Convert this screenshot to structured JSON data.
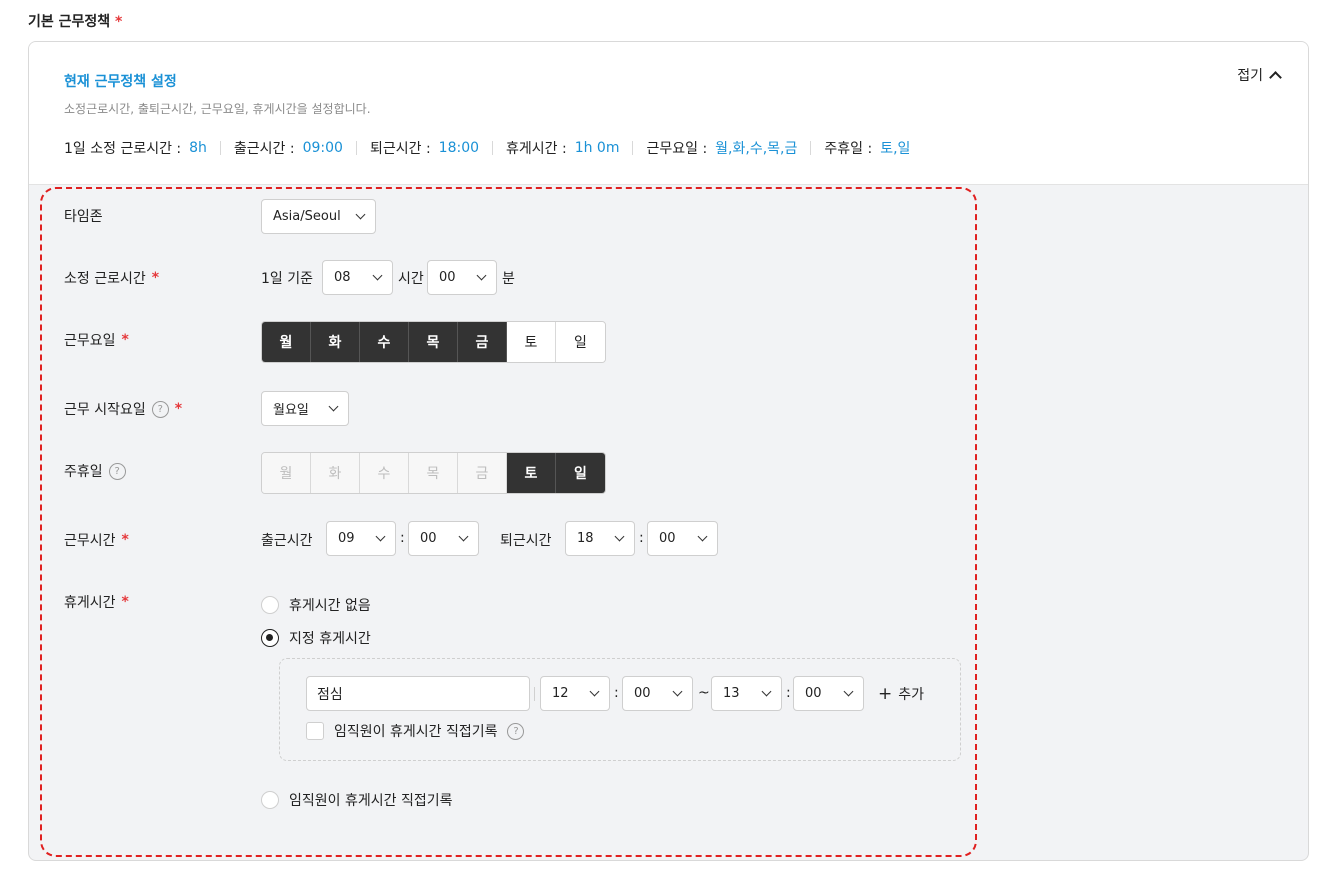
{
  "section": {
    "title": "기본 근무정책",
    "required_mark": "*"
  },
  "header": {
    "title": "현재 근무정책 설정",
    "description": "소정근로시간, 출퇴근시간, 근무요일, 휴게시간을 설정합니다.",
    "collapse_label": "접기",
    "summary": [
      {
        "label": "1일 소정 근로시간 :",
        "value": "8h"
      },
      {
        "label": "출근시간 :",
        "value": "09:00"
      },
      {
        "label": "퇴근시간 :",
        "value": "18:00"
      },
      {
        "label": "휴게시간 :",
        "value": "1h 0m"
      },
      {
        "label": "근무요일 :",
        "value": "월,화,수,목,금"
      },
      {
        "label": "주휴일 :",
        "value": "토,일"
      }
    ]
  },
  "form": {
    "timezone": {
      "label": "타임존",
      "value": "Asia/Seoul"
    },
    "work_hours": {
      "label": "소정 근로시간",
      "prefix": "1일 기준",
      "hours": "08",
      "hours_unit": "시간",
      "minutes": "00",
      "minutes_unit": "분"
    },
    "work_days": {
      "label": "근무요일",
      "days": [
        {
          "label": "월",
          "selected": true
        },
        {
          "label": "화",
          "selected": true
        },
        {
          "label": "수",
          "selected": true
        },
        {
          "label": "목",
          "selected": true
        },
        {
          "label": "금",
          "selected": true
        },
        {
          "label": "토",
          "selected": false
        },
        {
          "label": "일",
          "selected": false
        }
      ]
    },
    "week_start": {
      "label": "근무 시작요일",
      "value": "월요일"
    },
    "weekly_holiday": {
      "label": "주휴일",
      "days": [
        {
          "label": "월",
          "state": "disabled"
        },
        {
          "label": "화",
          "state": "disabled"
        },
        {
          "label": "수",
          "state": "disabled"
        },
        {
          "label": "목",
          "state": "disabled"
        },
        {
          "label": "금",
          "state": "disabled"
        },
        {
          "label": "토",
          "state": "selected"
        },
        {
          "label": "일",
          "state": "selected"
        }
      ]
    },
    "work_time": {
      "label": "근무시간",
      "start_label": "출근시간",
      "start_hour": "09",
      "start_min": "00",
      "end_label": "퇴근시간",
      "end_hour": "18",
      "end_min": "00",
      "colon": ":"
    },
    "break_time": {
      "label": "휴게시간",
      "options": [
        {
          "label": "휴게시간 없음",
          "checked": false
        },
        {
          "label": "지정 휴게시간",
          "checked": true
        },
        {
          "label": "임직원이 휴게시간 직접기록",
          "checked": false
        }
      ],
      "entry": {
        "name": "점심",
        "start_hour": "12",
        "start_min": "00",
        "tilde": "~",
        "end_hour": "13",
        "end_min": "00",
        "add_label": "추가",
        "self_record_label": "임직원이 휴게시간 직접기록"
      }
    }
  },
  "colors": {
    "accent": "#1a91d6",
    "required": "#e5383b",
    "selected_day": "#333333",
    "highlight_border": "#e02020"
  }
}
